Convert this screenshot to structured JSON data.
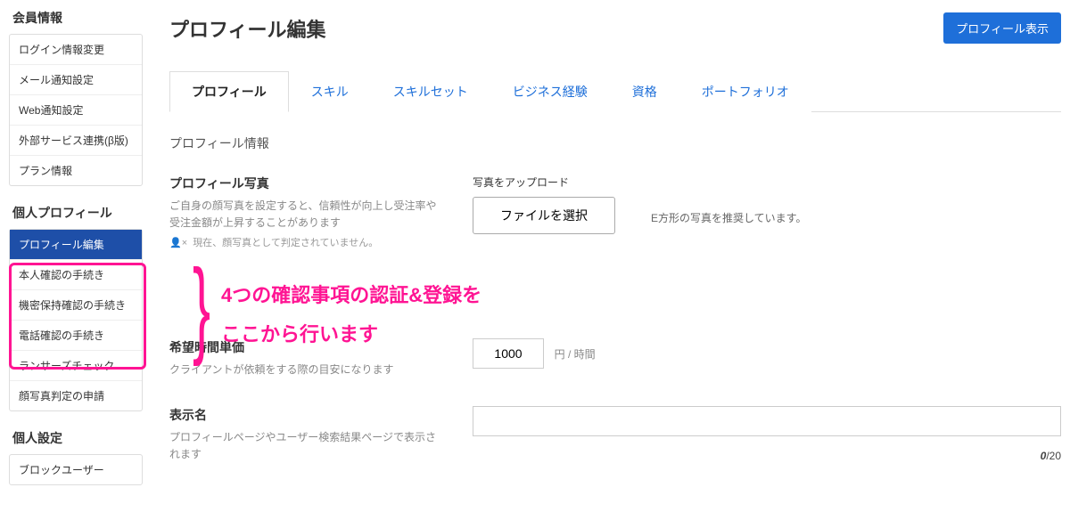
{
  "sidebar": {
    "section1": {
      "title": "会員情報",
      "items": [
        "ログイン情報変更",
        "メール通知設定",
        "Web通知設定",
        "外部サービス連携(β版)",
        "プラン情報"
      ]
    },
    "section2": {
      "title": "個人プロフィール",
      "items": [
        "プロフィール編集",
        "本人確認の手続き",
        "機密保持確認の手続き",
        "電話確認の手続き",
        "ランサーズチェック",
        "顔写真判定の申請"
      ]
    },
    "section3": {
      "title": "個人設定",
      "items": [
        "ブロックユーザー"
      ]
    }
  },
  "header": {
    "title": "プロフィール編集",
    "button": "プロフィール表示"
  },
  "tabs": [
    "プロフィール",
    "スキル",
    "スキルセット",
    "ビジネス経験",
    "資格",
    "ポートフォリオ"
  ],
  "section_heading": "プロフィール情報",
  "photo": {
    "label": "プロフィール写真",
    "help": "ご自身の顔写真を設定すると、信頼性が向上し受注率や受注金額が上昇することがあります",
    "note": "現在、顔写真として判定されていません。",
    "upload_label": "写真をアップロード",
    "file_button": "ファイルを選択",
    "recommend": "E方形の写真を推奨しています。"
  },
  "rate": {
    "label": "希望時間単価",
    "help": "クライアントが依頼をする際の目安になります",
    "value": "1000",
    "unit": "円 / 時間"
  },
  "display_name": {
    "label": "表示名",
    "help": "プロフィールページやユーザー検索結果ページで表示されます",
    "count_current": "0",
    "count_max": "/20"
  },
  "annotation": {
    "line1": "4つの確認事項の認証&登録を",
    "line2": "ここから行います"
  }
}
